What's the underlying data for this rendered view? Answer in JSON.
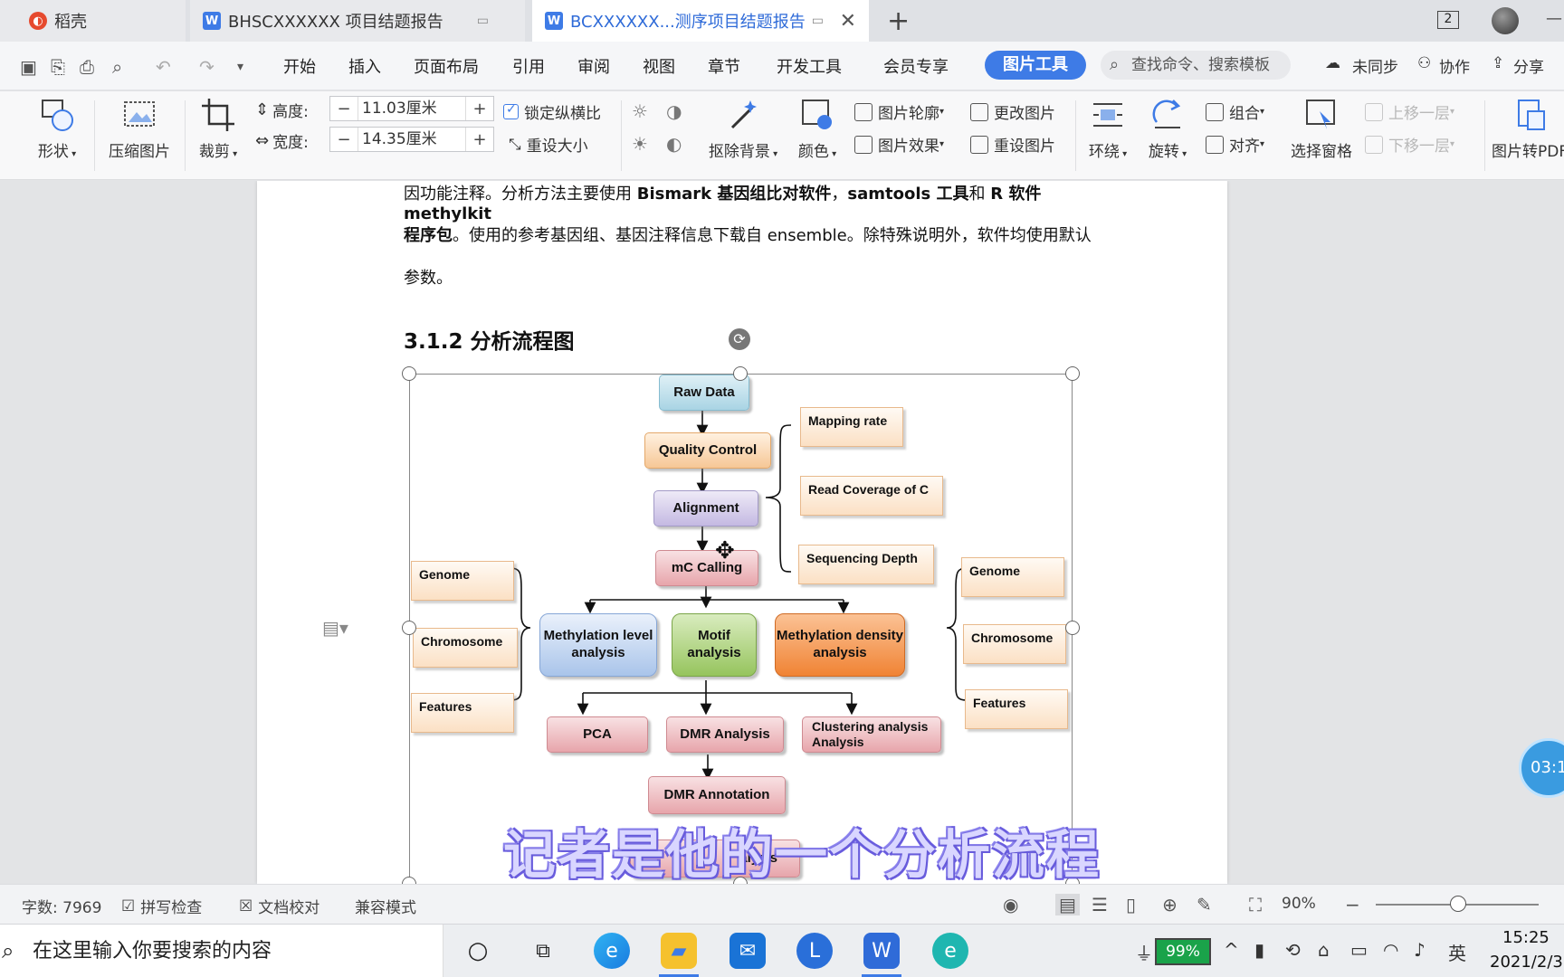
{
  "tabs": [
    {
      "label": "稻壳"
    },
    {
      "label": "BHSCXXXXXX 项目结题报告"
    },
    {
      "label": "BCXXXXXX...测序项目结题报告"
    }
  ],
  "tab_add": "+",
  "window_count": "2",
  "menu": {
    "items": [
      "开始",
      "插入",
      "页面布局",
      "引用",
      "审阅",
      "视图",
      "章节",
      "开发工具",
      "会员专享"
    ],
    "active": "图片工具",
    "search_placeholder": "查找命令、搜索模板",
    "unsynced": "未同步",
    "collaborate": "协作",
    "share": "分享"
  },
  "ribbon": {
    "shape": "形状",
    "compress": "压缩图片",
    "crop": "裁剪",
    "height_label": "高度:",
    "height_value": "11.03厘米",
    "width_label": "宽度:",
    "width_value": "14.35厘米",
    "minus": "−",
    "plus": "+",
    "lock_ratio": "锁定纵横比",
    "reset_size": "重设大小",
    "remove_bg": "抠除背景",
    "color": "颜色",
    "outline": "图片轮廓",
    "effects": "图片效果",
    "change_pic": "更改图片",
    "reset_pic": "重设图片",
    "wrap": "环绕",
    "rotate": "旋转",
    "group": "组合",
    "align": "对齐",
    "select_pane": "选择窗格",
    "bring_forward": "上移一层",
    "send_backward": "下移一层",
    "to_pdf": "图片转PDF"
  },
  "document": {
    "line1_pre": "因功能注释。分析方法主要使用 ",
    "line1_b1": "Bismark 基因组比对软件",
    "line1_mid": "，",
    "line1_b2": "samtools 工具",
    "line1_and": "和 ",
    "line1_b3": "R 软件 methylkit",
    "line2_b": "程序包",
    "line2_rest": "。使用的参考基因组、基因注释信息下载自 ensemble。除特殊说明外，软件均使用默认",
    "line3": "参数。",
    "heading": "3.1.2  分析流程图"
  },
  "flowchart": {
    "raw_data": "Raw Data",
    "quality_control": "Quality Control",
    "alignment": "Alignment",
    "mc_calling": "mC Calling",
    "methylation_level": "Methylation level analysis",
    "motif": "Motif analysis",
    "methylation_density": "Methylation density analysis",
    "pca": "PCA",
    "dmr_analysis": "DMR Analysis",
    "clustering": "Clustering analysis Analysis",
    "dmr_annotation": "DMR Annotation",
    "bottom_partial": "alysis",
    "mapping_rate": "Mapping rate",
    "read_coverage": "Read Coverage of C",
    "sequencing_depth": "Sequencing Depth",
    "left_genome": "Genome",
    "left_chromosome": "Chromosome",
    "left_features": "Features",
    "right_genome": "Genome",
    "right_chromosome": "Chromosome",
    "right_features": "Features"
  },
  "subtitle": "记者是他的一个分析流程",
  "timer": "03:1",
  "status": {
    "word_count": "字数: 7969",
    "spell_check": "拼写检查",
    "doc_proof": "文档校对",
    "compat_mode": "兼容模式",
    "zoom": "90%"
  },
  "taskbar": {
    "search_placeholder": "在这里输入你要搜索的内容",
    "battery": "99%",
    "ime": "英",
    "time": "15:25",
    "date": "2021/2/3"
  },
  "colors": {
    "accent": "#3e7be6",
    "battery": "#1aa34a"
  }
}
